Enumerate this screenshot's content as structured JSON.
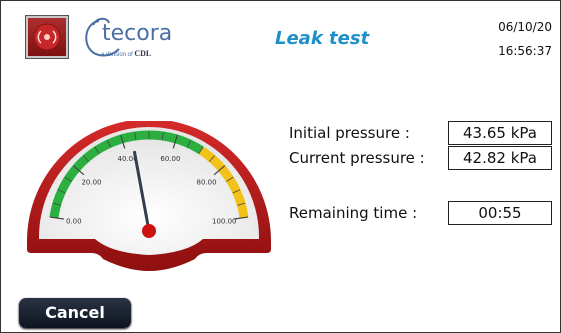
{
  "header": {
    "logo_text": "tecora",
    "logo_sub_prefix": "a division of",
    "logo_sub_brand": "CDL",
    "title": "Leak test",
    "date": "06/10/20",
    "time": "16:56:37"
  },
  "gauge": {
    "ticks": [
      "0.00",
      "20.00",
      "40.00",
      "60.00",
      "80.00",
      "100.00"
    ],
    "min": 0,
    "max": 100,
    "needle_value": 43.65,
    "green_until": 70,
    "yellow_from": 70,
    "colors": {
      "frame": "#b81c1c",
      "green": "#2bb040",
      "yellow": "#f2c21a",
      "needle": "#333d4c",
      "hub": "#cc1111"
    }
  },
  "readings": {
    "initial_label": "Initial pressure :",
    "initial_value": "43.65 kPa",
    "current_label": "Current pressure :",
    "current_value": "42.82 kPa",
    "remaining_label": "Remaining time :",
    "remaining_value": "00:55"
  },
  "footer": {
    "cancel_label": "Cancel"
  }
}
